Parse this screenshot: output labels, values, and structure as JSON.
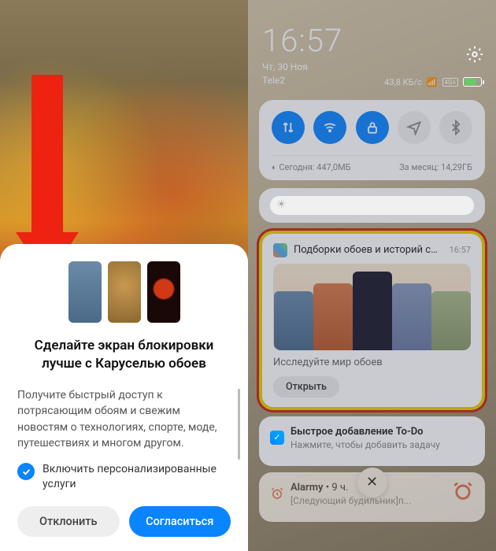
{
  "left": {
    "dialog": {
      "title": "Сделайте экран блокировки лучше с Каруселью обоев",
      "body": "Получите быстрый доступ к потрясающим обоям и свежим новостям о технологиях, спорте, моде, путешествиях и многом другом.",
      "checkbox_label": "Включить персонализированные услуги",
      "checkbox_checked": true,
      "reject_label": "Отклонить",
      "accept_label": "Согласиться"
    }
  },
  "right": {
    "status": {
      "time": "16:57",
      "date": "Чт, 30 Ноя",
      "carrier": "Tele2",
      "speed": "43,8 КБ/с",
      "network_badge": "4G+",
      "battery_pct": 72
    },
    "toggles": {
      "items": [
        "data",
        "wifi",
        "lock",
        "location",
        "bluetooth"
      ],
      "data_today_label": "Сегодня: 447,0МБ",
      "data_month_label": "За месяц: 14,29ГБ"
    },
    "notifications": [
      {
        "app": "wallpaper-carousel",
        "title": "Подборки обоев и историй специ..",
        "time": "16:57",
        "subtitle": "Исследуйте мир обоев",
        "action": "Открыть",
        "highlighted": true
      },
      {
        "app": "todo",
        "title": "Быстрое добавление To-Do",
        "subtitle": "Нажмите, чтобы добавить задачу"
      },
      {
        "app": "alarmy",
        "title": "Alarmy",
        "meta": "9 ч.",
        "subtitle": "[Следующий будильник]п..."
      }
    ],
    "close_label": "✕"
  }
}
